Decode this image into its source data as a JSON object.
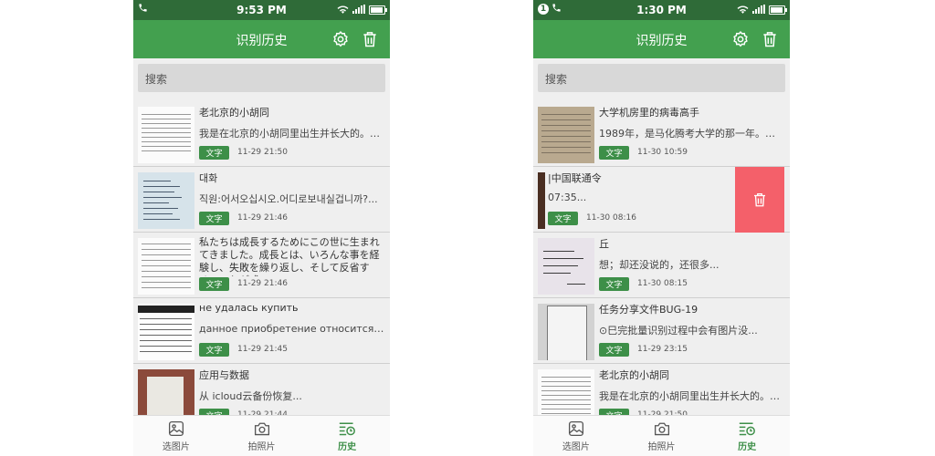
{
  "screens": [
    {
      "status": {
        "time": "9:53 PM"
      },
      "header": {
        "title": "识别历史"
      },
      "search": {
        "placeholder": "搜索"
      },
      "items": [
        {
          "title": "老北京的小胡同",
          "preview": "我是在北京的小胡同里出生并长大的。由于...",
          "tag": "文字",
          "time": "11-29 21:50"
        },
        {
          "title": "대화",
          "preview": "직원:어서오십시오.어디로보내실겁니까?...",
          "tag": "文字",
          "time": "11-29 21:46"
        },
        {
          "title": "私たちは成長するためにこの世に生まれてきました。成長とは、いろんな事を経験し、失敗を繰り返し、そして反省する、これが成...",
          "preview": "",
          "tag": "文字",
          "time": "11-29 21:46"
        },
        {
          "title": "не   удалась   купить",
          "preview": "данное приобретение   относится к при...",
          "tag": "文字",
          "time": "11-29 21:45"
        },
        {
          "title": "应用与数据",
          "preview": "从    icloud云备份恢复...",
          "tag": "文字",
          "time": "11-29 21:44"
        }
      ],
      "tabs": [
        {
          "label": "选图片"
        },
        {
          "label": "拍照片"
        },
        {
          "label": "历史"
        }
      ]
    },
    {
      "status": {
        "time": "1:30 PM",
        "badge": "1"
      },
      "header": {
        "title": "识别历史"
      },
      "search": {
        "placeholder": "搜索"
      },
      "items": [
        {
          "title": "大学机房里的病毒高手",
          "preview": "1989年，是马化腾考大学的那一年。那年6...",
          "tag": "文字",
          "time": "11-30 10:59"
        },
        {
          "title": "|中国联通令",
          "preview": "07:35...",
          "tag": "文字",
          "time": "11-30 08:16"
        },
        {
          "title": "丘",
          "preview": "想；却还没说的，还很多...",
          "tag": "文字",
          "time": "11-30 08:15"
        },
        {
          "title": "任务分享文件BUG-19",
          "preview": "⊙巳完批量识别过程中会有图片没...",
          "tag": "文字",
          "time": "11-29 23:15"
        },
        {
          "title": "老北京的小胡同",
          "preview": "我是在北京的小胡同里出生并长大的。由于...",
          "tag": "文字",
          "time": "11-29 21:50"
        }
      ],
      "tabs": [
        {
          "label": "选图片"
        },
        {
          "label": "拍照片"
        },
        {
          "label": "历史"
        }
      ]
    }
  ],
  "colors": {
    "status_bar": "#2f6b38",
    "app_bar": "#43a04f",
    "tag": "#3d8f48",
    "delete": "#f4606a",
    "active_tab": "#3d8f48"
  }
}
